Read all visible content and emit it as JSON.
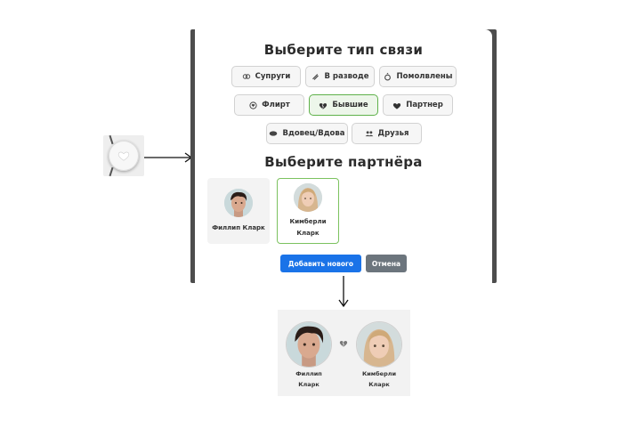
{
  "modal": {
    "title_type": "Выберите тип связи",
    "title_partner": "Выберите партнёра",
    "types": [
      {
        "label": "Супруги",
        "icon": "rings-icon",
        "active": false
      },
      {
        "label": "В разводе",
        "icon": "broken-rings-icon",
        "active": false
      },
      {
        "label": "Помолвлены",
        "icon": "ring-icon",
        "active": false
      },
      {
        "label": "Флирт",
        "icon": "chat-heart-icon",
        "active": false
      },
      {
        "label": "Бывшие",
        "icon": "broken-heart-icon",
        "active": true
      },
      {
        "label": "Партнер",
        "icon": "heart-icon",
        "active": false
      },
      {
        "label": "Вдовец/Вдова",
        "icon": "cameo-icon",
        "active": false
      },
      {
        "label": "Друзья",
        "icon": "people-icon",
        "active": false
      }
    ],
    "partners": [
      {
        "name": "Филлип Кларк",
        "selected": false
      },
      {
        "name_line1": "Кимберли",
        "name_line2": "Кларк",
        "selected": true
      }
    ],
    "add_new_label": "Добавить нового",
    "cancel_label": "Отмена"
  },
  "result": {
    "left_name_line1": "Филлип",
    "left_name_line2": "Кларк",
    "right_name_line1": "Кимберли",
    "right_name_line2": "Кларк"
  },
  "colors": {
    "accent_blue": "#1a73e8",
    "cancel_gray": "#6c757d",
    "active_green": "#5fb14a"
  }
}
